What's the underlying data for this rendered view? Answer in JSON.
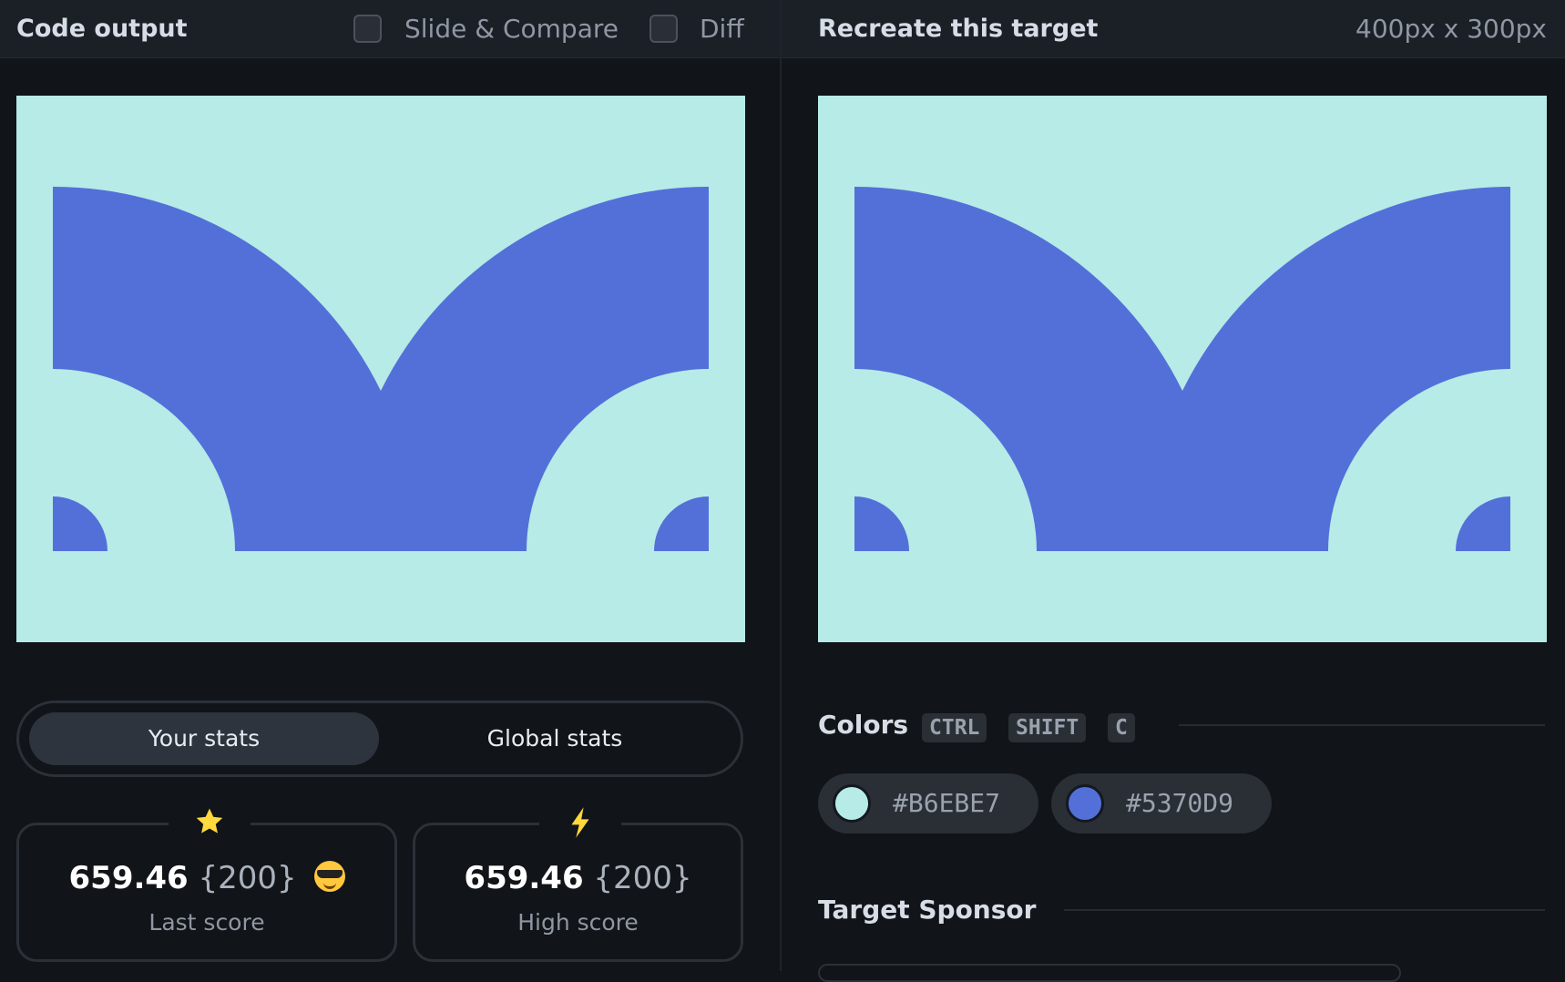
{
  "left_panel": {
    "title": "Code output",
    "slide_compare_label": "Slide & Compare",
    "slide_compare_checked": false,
    "diff_label": "Diff",
    "diff_checked": false
  },
  "right_panel": {
    "title": "Recreate this target",
    "dimensions": "400px x 300px"
  },
  "stats_tabs": {
    "your_stats": "Your stats",
    "global_stats": "Global stats",
    "active": "your_stats"
  },
  "last_score": {
    "icon": "star-icon",
    "score": "659.46",
    "count": "{200}",
    "emoji": "sunglasses-emoji",
    "label": "Last score"
  },
  "high_score": {
    "icon": "bolt-icon",
    "score": "659.46",
    "count": "{200}",
    "label": "High score"
  },
  "colors": {
    "title": "Colors",
    "shortcut": [
      "CTRL",
      "SHIFT",
      "C"
    ],
    "swatches": [
      {
        "hex": "#B6EBE7",
        "label": "#B6EBE7"
      },
      {
        "hex": "#5370D9",
        "label": "#5370D9"
      }
    ]
  },
  "sponsor": {
    "title": "Target Sponsor"
  },
  "theme": {
    "background": "#111418",
    "panel_bar": "#1b1f26",
    "target_bg": "#B6EBE7",
    "target_fg": "#5370D9",
    "star_color": "#ffd93d"
  }
}
